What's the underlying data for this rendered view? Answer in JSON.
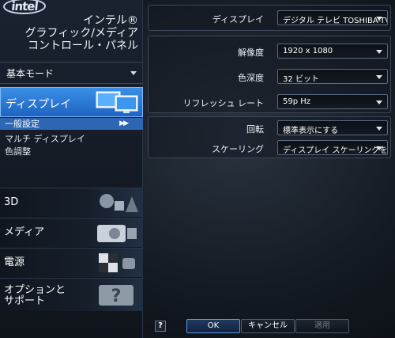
{
  "header": {
    "logo_text": "intel",
    "title_lines": [
      "インテル®",
      "グラフィック/メディア",
      "コントロール・パネル"
    ]
  },
  "mode": {
    "label": "基本モード"
  },
  "nav": {
    "display": {
      "label": "ディスプレイ"
    },
    "display_sub": [
      {
        "label": "一般設定",
        "active": true
      },
      {
        "label": "マルチ ディスプレイ",
        "active": false
      },
      {
        "label": "色調整",
        "active": false
      }
    ],
    "categories": [
      {
        "label": "3D"
      },
      {
        "label": "メディア"
      },
      {
        "label": "電源"
      },
      {
        "label": "オプションと\nサポート"
      }
    ]
  },
  "settings": {
    "display": {
      "label": "ディスプレイ",
      "value": "デジタル テレビ TOSHIBA-TV"
    },
    "resolution": {
      "label": "解像度",
      "value": "1920 x 1080"
    },
    "color_depth": {
      "label": "色深度",
      "value": "32 ビット"
    },
    "refresh_rate": {
      "label": "リフレッシュ レート",
      "value": "59p Hz"
    },
    "rotation": {
      "label": "回転",
      "value": "標準表示にする"
    },
    "scaling": {
      "label": "スケーリング",
      "value": "ディスプレイ スケーリングを保..."
    }
  },
  "footer": {
    "help": "?",
    "ok": "OK",
    "cancel": "キャンセル",
    "apply": "適用"
  },
  "colors": {
    "accent": "#2d66b3",
    "highlight": "#3a8fe6"
  }
}
